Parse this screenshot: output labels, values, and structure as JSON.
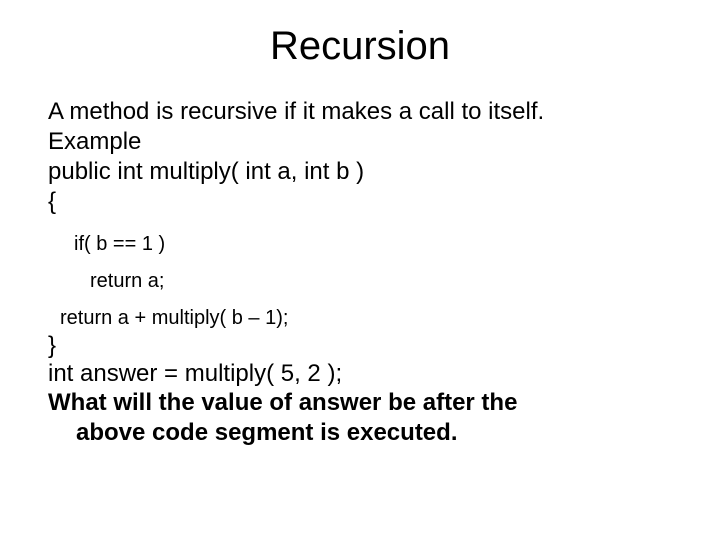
{
  "title": "Recursion",
  "lines": {
    "l1": "A method is recursive if it makes a call to itself.",
    "l2": "Example",
    "l3": "public int multiply( int a, int b )",
    "l4": "{",
    "c1": "if( b == 1 )",
    "c2": "return a;",
    "c3": "return a + multiply( b – 1);",
    "l5": "}",
    "l6": "int answer = multiply( 5, 2 );",
    "q1": "What will the value of answer be after the",
    "q2": "above code segment is executed."
  }
}
